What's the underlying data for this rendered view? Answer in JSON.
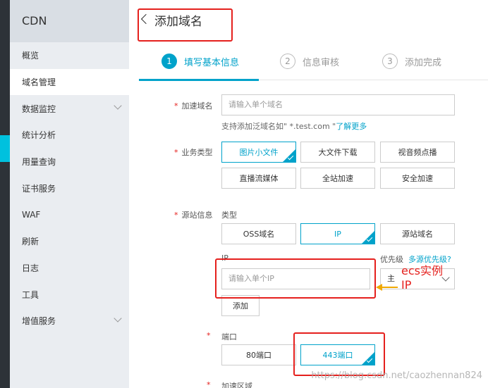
{
  "sidebar": {
    "title": "CDN",
    "items": [
      {
        "label": "概览",
        "active": false
      },
      {
        "label": "域名管理",
        "active": true
      },
      {
        "label": "数据监控",
        "active": false,
        "expandable": true
      },
      {
        "label": "统计分析",
        "active": false
      },
      {
        "label": "用量查询",
        "active": false
      },
      {
        "label": "证书服务",
        "active": false
      },
      {
        "label": "WAF",
        "active": false
      },
      {
        "label": "刷新",
        "active": false
      },
      {
        "label": "日志",
        "active": false
      },
      {
        "label": "工具",
        "active": false
      },
      {
        "label": "增值服务",
        "active": false,
        "expandable": true
      }
    ]
  },
  "header": {
    "title": "添加域名"
  },
  "steps": [
    {
      "num": "1",
      "label": "填写基本信息",
      "active": true
    },
    {
      "num": "2",
      "label": "信息审核",
      "active": false
    },
    {
      "num": "3",
      "label": "添加完成",
      "active": false
    }
  ],
  "form": {
    "domain": {
      "label": "加速域名",
      "placeholder": "请输入单个域名",
      "hint_prefix": "支持添加泛域名如\" *.test.com \"",
      "hint_link": "了解更多"
    },
    "business": {
      "label": "业务类型",
      "options": [
        "图片小文件",
        "大文件下载",
        "视音频点播",
        "直播流媒体",
        "全站加速",
        "安全加速"
      ],
      "selected": "图片小文件"
    },
    "origin": {
      "label": "源站信息",
      "type_label": "类型",
      "types": [
        "OSS域名",
        "IP",
        "源站域名"
      ],
      "selected": "IP",
      "ip_label": "IP",
      "ip_placeholder": "请输入单个IP",
      "priority_label": "优先级",
      "priority_link": "多源优先级?",
      "priority_value": "主",
      "add_label": "添加"
    },
    "port": {
      "label": "端口",
      "options": [
        "80端口",
        "443端口"
      ],
      "selected": "443端口"
    },
    "region": {
      "label": "加速区域"
    }
  },
  "annotation": {
    "text_line1": "ecs实例",
    "text_line2": "IP"
  },
  "watermark": "https://blog.csdn.net/caozhennan824",
  "colors": {
    "accent": "#00a2ca",
    "annotation": "#e5201d",
    "arrow": "#f0a800",
    "sidebar_bg": "#eaedf1"
  }
}
